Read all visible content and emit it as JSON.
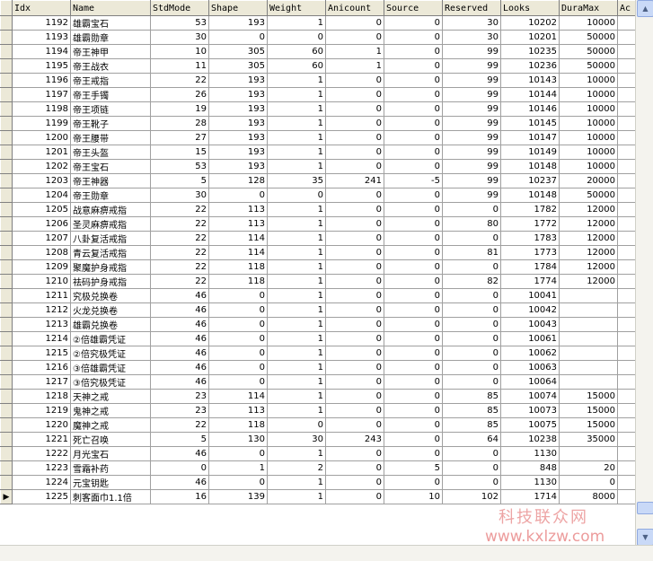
{
  "grid": {
    "columns": [
      "Idx",
      "Name",
      "StdMode",
      "Shape",
      "Weight",
      "Anicount",
      "Source",
      "Reserved",
      "Looks",
      "DuraMax",
      "Ac"
    ],
    "current_row_marker": "▶",
    "rows": [
      [
        "1192",
        "雄霸宝石",
        "53",
        "193",
        "1",
        "0",
        "0",
        "30",
        "10202",
        "10000"
      ],
      [
        "1193",
        "雄霸勋章",
        "30",
        "0",
        "0",
        "0",
        "0",
        "30",
        "10201",
        "50000"
      ],
      [
        "1194",
        "帝王神甲",
        "10",
        "305",
        "60",
        "1",
        "0",
        "99",
        "10235",
        "50000"
      ],
      [
        "1195",
        "帝王战衣",
        "11",
        "305",
        "60",
        "1",
        "0",
        "99",
        "10236",
        "50000"
      ],
      [
        "1196",
        "帝王戒指",
        "22",
        "193",
        "1",
        "0",
        "0",
        "99",
        "10143",
        "10000"
      ],
      [
        "1197",
        "帝王手镯",
        "26",
        "193",
        "1",
        "0",
        "0",
        "99",
        "10144",
        "10000"
      ],
      [
        "1198",
        "帝王项链",
        "19",
        "193",
        "1",
        "0",
        "0",
        "99",
        "10146",
        "10000"
      ],
      [
        "1199",
        "帝王靴子",
        "28",
        "193",
        "1",
        "0",
        "0",
        "99",
        "10145",
        "10000"
      ],
      [
        "1200",
        "帝王腰带",
        "27",
        "193",
        "1",
        "0",
        "0",
        "99",
        "10147",
        "10000"
      ],
      [
        "1201",
        "帝王头盔",
        "15",
        "193",
        "1",
        "0",
        "0",
        "99",
        "10149",
        "10000"
      ],
      [
        "1202",
        "帝王宝石",
        "53",
        "193",
        "1",
        "0",
        "0",
        "99",
        "10148",
        "10000"
      ],
      [
        "1203",
        "帝王神器",
        "5",
        "128",
        "35",
        "241",
        "-5",
        "99",
        "10237",
        "20000"
      ],
      [
        "1204",
        "帝王勋章",
        "30",
        "0",
        "0",
        "0",
        "0",
        "99",
        "10148",
        "50000"
      ],
      [
        "1205",
        "战意麻痹戒指",
        "22",
        "113",
        "1",
        "0",
        "0",
        "0",
        "1782",
        "12000"
      ],
      [
        "1206",
        "圣灵麻痹戒指",
        "22",
        "113",
        "1",
        "0",
        "0",
        "80",
        "1772",
        "12000"
      ],
      [
        "1207",
        "八卦复活戒指",
        "22",
        "114",
        "1",
        "0",
        "0",
        "0",
        "1783",
        "12000"
      ],
      [
        "1208",
        "青云复活戒指",
        "22",
        "114",
        "1",
        "0",
        "0",
        "81",
        "1773",
        "12000"
      ],
      [
        "1209",
        "聚魔护身戒指",
        "22",
        "118",
        "1",
        "0",
        "0",
        "0",
        "1784",
        "12000"
      ],
      [
        "1210",
        "祛码护身戒指",
        "22",
        "118",
        "1",
        "0",
        "0",
        "82",
        "1774",
        "12000"
      ],
      [
        "1211",
        "究极兑换卷",
        "46",
        "0",
        "1",
        "0",
        "0",
        "0",
        "10041",
        ""
      ],
      [
        "1212",
        "火龙兑换卷",
        "46",
        "0",
        "1",
        "0",
        "0",
        "0",
        "10042",
        ""
      ],
      [
        "1213",
        "雄霸兑换卷",
        "46",
        "0",
        "1",
        "0",
        "0",
        "0",
        "10043",
        ""
      ],
      [
        "1214",
        "②倍雄霸凭证",
        "46",
        "0",
        "1",
        "0",
        "0",
        "0",
        "10061",
        ""
      ],
      [
        "1215",
        "②倍究极凭证",
        "46",
        "0",
        "1",
        "0",
        "0",
        "0",
        "10062",
        ""
      ],
      [
        "1216",
        "③倍雄霸凭证",
        "46",
        "0",
        "1",
        "0",
        "0",
        "0",
        "10063",
        ""
      ],
      [
        "1217",
        "③倍究极凭证",
        "46",
        "0",
        "1",
        "0",
        "0",
        "0",
        "10064",
        ""
      ],
      [
        "1218",
        "天神之戒",
        "23",
        "114",
        "1",
        "0",
        "0",
        "85",
        "10074",
        "15000"
      ],
      [
        "1219",
        "鬼神之戒",
        "23",
        "113",
        "1",
        "0",
        "0",
        "85",
        "10073",
        "15000"
      ],
      [
        "1220",
        "魔神之戒",
        "22",
        "118",
        "0",
        "0",
        "0",
        "85",
        "10075",
        "15000"
      ],
      [
        "1221",
        "死亡召唤",
        "5",
        "130",
        "30",
        "243",
        "0",
        "64",
        "10238",
        "35000"
      ],
      [
        "1222",
        "月光宝石",
        "46",
        "0",
        "1",
        "0",
        "0",
        "0",
        "1130",
        ""
      ],
      [
        "1223",
        "雪霜补药",
        "0",
        "1",
        "2",
        "0",
        "5",
        "0",
        "848",
        "20"
      ],
      [
        "1224",
        "元宝钥匙",
        "46",
        "0",
        "1",
        "0",
        "0",
        "0",
        "1130",
        "0"
      ],
      [
        "1225",
        "刺客面巾1.1倍",
        "16",
        "139",
        "1",
        "0",
        "10",
        "102",
        "1714",
        "8000"
      ]
    ]
  },
  "scrollbar": {
    "up_arrow": "▲",
    "down_arrow": "▼",
    "position": 0.97
  },
  "watermark": {
    "line1": "科技联众网",
    "line2": "www.kxlzw.com"
  }
}
